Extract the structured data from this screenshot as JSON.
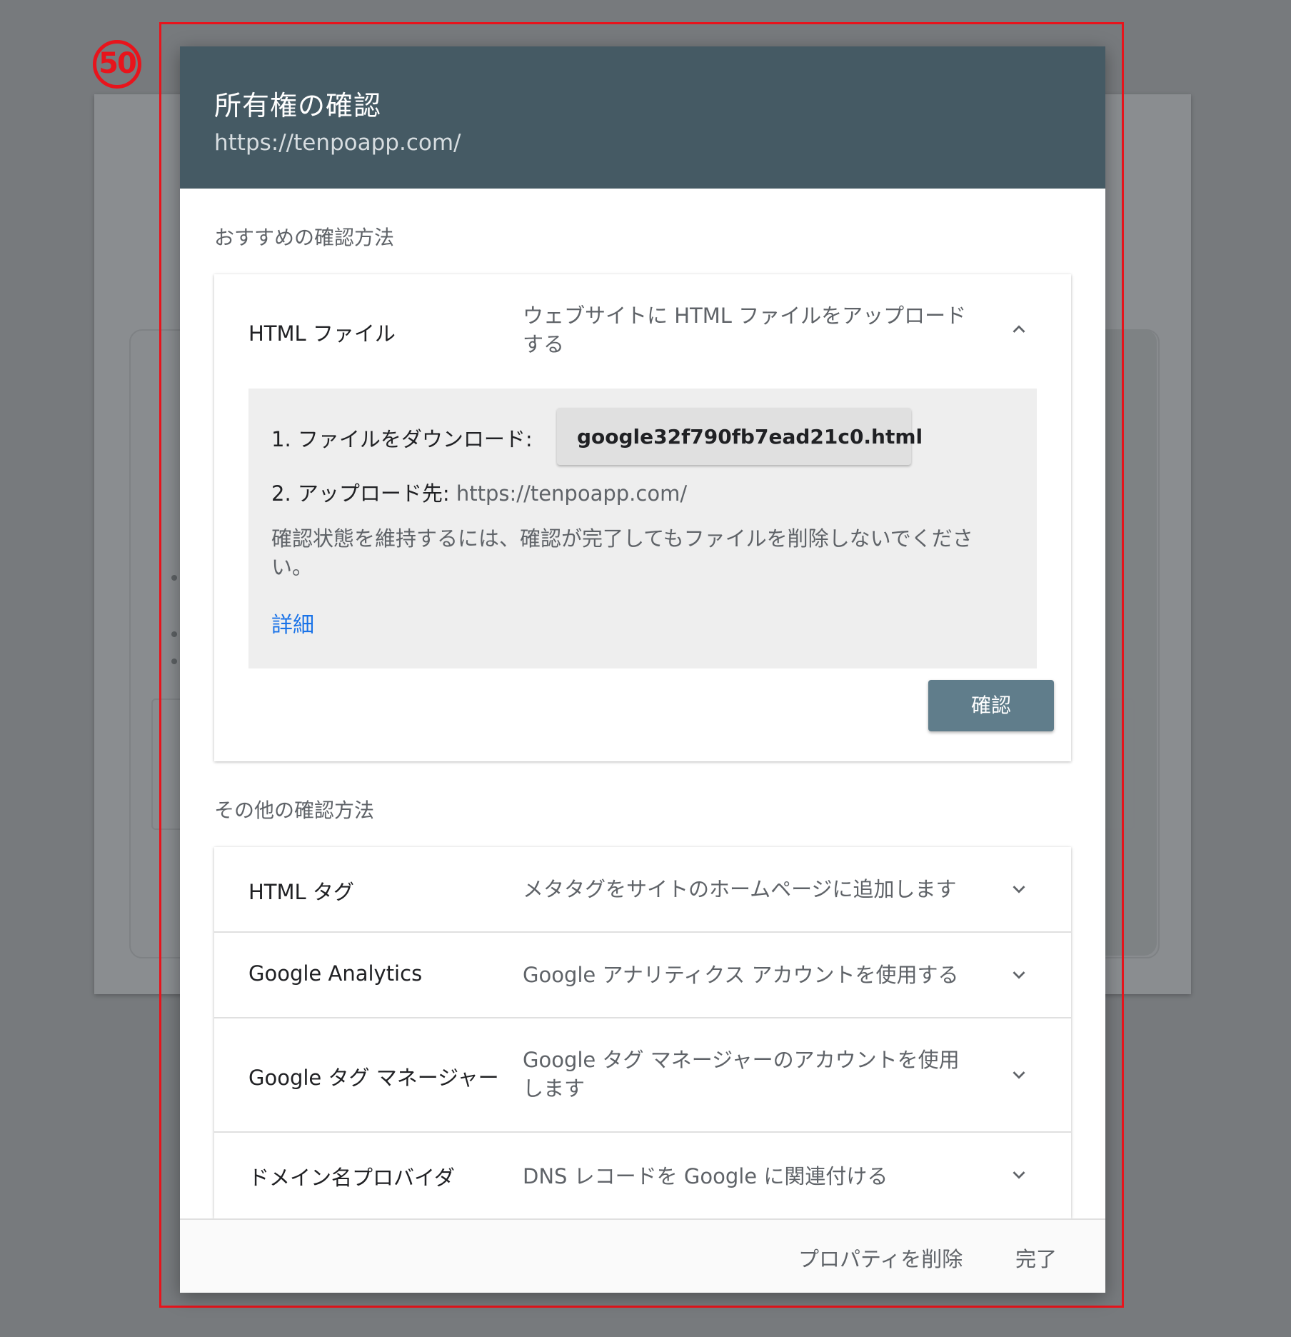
{
  "annotation": {
    "number": "50"
  },
  "dialog": {
    "title": "所有権の確認",
    "url": "https://tenpoapp.com/"
  },
  "recommended": {
    "section_label": "おすすめの確認方法",
    "method": {
      "title": "HTML ファイル",
      "description": "ウェブサイトに HTML ファイルをアップロードする",
      "step1_label": "1. ファイルをダウンロード:",
      "download_file": "google32f790fb7ead21c0.html",
      "step2_label": "2. アップロード先:",
      "step2_url": "https://tenpoapp.com/",
      "keep_note": "確認状態を維持するには、確認が完了してもファイルを削除しないでください。",
      "details_link": "詳細",
      "confirm_button": "確認"
    }
  },
  "other": {
    "section_label": "その他の確認方法",
    "methods": [
      {
        "title": "HTML タグ",
        "description": "メタタグをサイトのホームページに追加します"
      },
      {
        "title": "Google Analytics",
        "description": "Google アナリティクス アカウントを使用する"
      },
      {
        "title": "Google タグ マネージャー",
        "description": "Google タグ マネージャーのアカウントを使用します"
      },
      {
        "title": "ドメイン名プロバイダ",
        "description": "DNS レコードを Google に関連付ける"
      }
    ]
  },
  "footer": {
    "delete_property": "プロパティを削除",
    "done": "完了"
  },
  "colors": {
    "header": "#455a64",
    "confirm_button": "#607d8b",
    "link": "#1a73e8",
    "annotation": "#e8141c"
  },
  "icons": {
    "expand_less": "chevron-up-icon",
    "expand_more": "chevron-down-icon",
    "download": "download-icon"
  }
}
